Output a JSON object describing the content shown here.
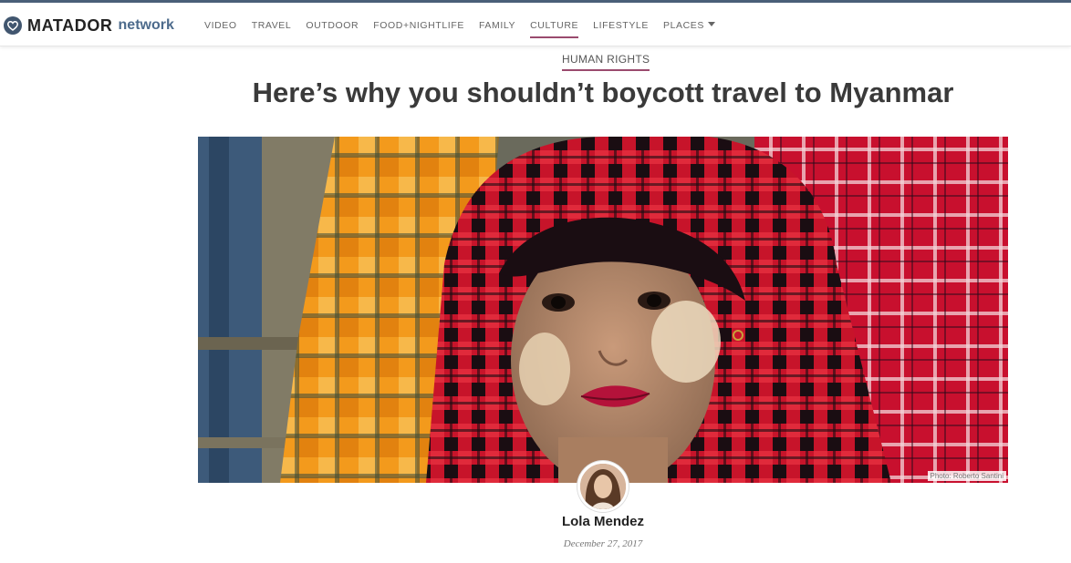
{
  "header": {
    "logo_word": "MATADOR",
    "logo_word_2": "network",
    "nav": [
      {
        "label": "VIDEO"
      },
      {
        "label": "TRAVEL"
      },
      {
        "label": "OUTDOOR"
      },
      {
        "label": "FOOD+NIGHTLIFE"
      },
      {
        "label": "FAMILY"
      },
      {
        "label": "CULTURE",
        "active": true
      },
      {
        "label": "LIFESTYLE"
      },
      {
        "label": "PLACES",
        "dropdown": true
      }
    ]
  },
  "article": {
    "category": "HUMAN RIGHTS",
    "title": "Here’s why you shouldn’t boycott travel to Myanmar",
    "photo_credit": "Photo: Roberto Santini",
    "author": "Lola Mendez",
    "date": "December 27, 2017"
  },
  "colors": {
    "accent": "#9a4a6e",
    "brand": "#41566f",
    "nav_text": "#666666"
  },
  "icons": {
    "logo": "matador-heart-logo-icon",
    "dropdown": "caret-down-icon"
  }
}
